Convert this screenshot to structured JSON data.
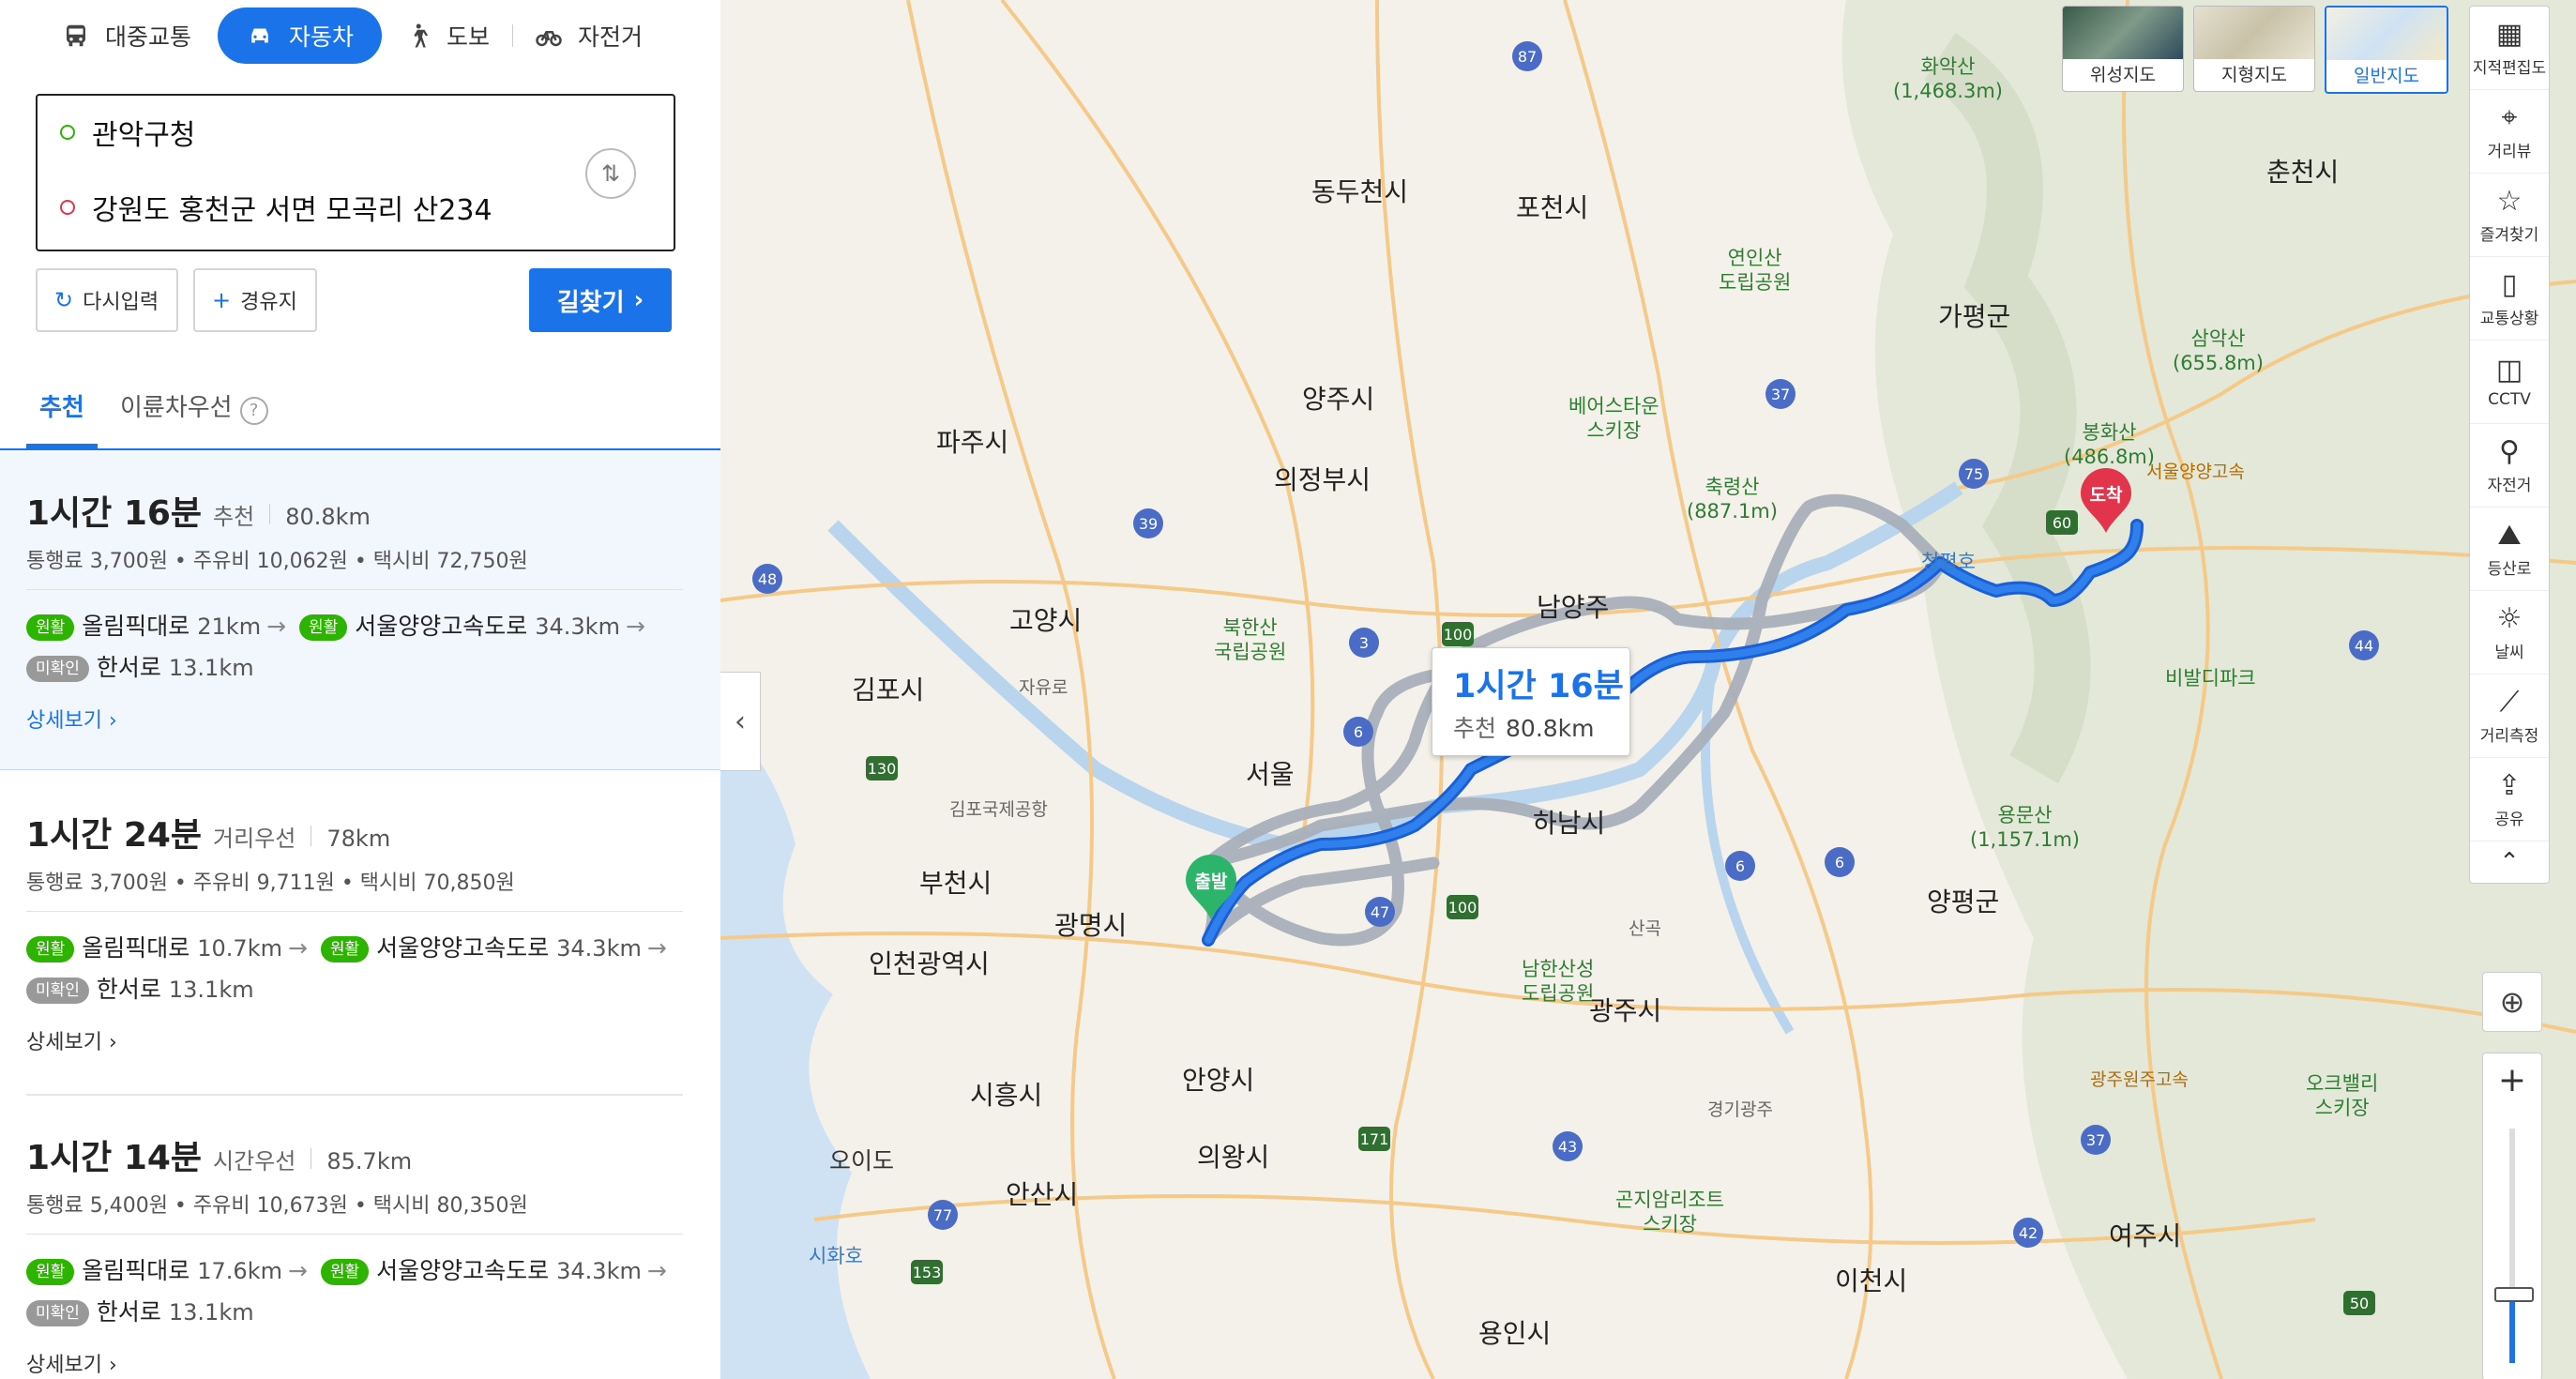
{
  "modes": [
    {
      "label": "대중교통",
      "icon": "bus-icon"
    },
    {
      "label": "자동차",
      "icon": "car-icon",
      "active": true
    },
    {
      "label": "도보",
      "icon": "walk-icon"
    },
    {
      "label": "자전거",
      "icon": "bicycle-icon"
    }
  ],
  "origin": "관악구청",
  "destination": "강원도 홍천군 서면 모곡리 산234",
  "buttons": {
    "reset": "다시입력",
    "waypoint": "경유지",
    "find": "길찾기"
  },
  "tabs": [
    "추천",
    "이륜차우선"
  ],
  "routes": [
    {
      "time": "1시간 16분",
      "tag": "추천",
      "distance": "80.8km",
      "costs": "통행료 3,700원 • 주유비 10,062원 • 택시비 72,750원",
      "roads": [
        {
          "badge": "원활",
          "name": "올림픽대로",
          "km": "21km"
        },
        {
          "badge": "원활",
          "name": "서울양양고속도로",
          "km": "34.3km"
        },
        {
          "badge": "미확인",
          "name": "한서로",
          "km": "13.1km"
        }
      ],
      "more": "상세보기"
    },
    {
      "time": "1시간 24분",
      "tag": "거리우선",
      "distance": "78km",
      "costs": "통행료 3,700원 • 주유비 9,711원 • 택시비 70,850원",
      "roads": [
        {
          "badge": "원활",
          "name": "올림픽대로",
          "km": "10.7km"
        },
        {
          "badge": "원활",
          "name": "서울양양고속도로",
          "km": "34.3km"
        },
        {
          "badge": "미확인",
          "name": "한서로",
          "km": "13.1km"
        }
      ],
      "more": "상세보기"
    },
    {
      "time": "1시간 14분",
      "tag": "시간우선",
      "distance": "85.7km",
      "costs": "통행료 5,400원 • 주유비 10,673원 • 택시비 80,350원",
      "roads": [
        {
          "badge": "원활",
          "name": "올림픽대로",
          "km": "17.6km"
        },
        {
          "badge": "원활",
          "name": "서울양양고속도로",
          "km": "34.3km"
        },
        {
          "badge": "미확인",
          "name": "한서로",
          "km": "13.1km"
        }
      ],
      "more": "상세보기"
    }
  ],
  "map": {
    "callout": {
      "time": "1시간 16분",
      "tag": "추천",
      "distance": "80.8km"
    },
    "start_pin": "출발",
    "end_pin": "도착",
    "map_types": [
      "위성지도",
      "지형지도",
      "일반지도"
    ],
    "active_map_type": "일반지도",
    "tools": [
      {
        "label": "지적편집도",
        "icon": "grid-icon"
      },
      {
        "label": "거리뷰",
        "icon": "pin-icon"
      },
      {
        "label": "즐겨찾기",
        "icon": "star-icon"
      },
      {
        "label": "교통상황",
        "icon": "traffic-light-icon"
      },
      {
        "label": "CCTV",
        "icon": "cctv-icon"
      },
      {
        "label": "자전거",
        "icon": "bicycle-icon"
      },
      {
        "label": "등산로",
        "icon": "mountain-icon"
      },
      {
        "label": "날씨",
        "icon": "sun-icon"
      },
      {
        "label": "거리측정",
        "icon": "ruler-icon"
      },
      {
        "label": "공유",
        "icon": "share-icon"
      }
    ],
    "zoom_level_fraction": 0.3,
    "places": [
      {
        "name": "동두천시"
      },
      {
        "name": "포천시"
      },
      {
        "name": "파주시"
      },
      {
        "name": "양주시"
      },
      {
        "name": "의정부시"
      },
      {
        "name": "가평군"
      },
      {
        "name": "춘천시"
      },
      {
        "name": "고양시"
      },
      {
        "name": "김포시"
      },
      {
        "name": "서울"
      },
      {
        "name": "부천시"
      },
      {
        "name": "광명시"
      },
      {
        "name": "인천광역시"
      },
      {
        "name": "하남시"
      },
      {
        "name": "남양주"
      },
      {
        "name": "양평군"
      },
      {
        "name": "광주시"
      },
      {
        "name": "안양시"
      },
      {
        "name": "시흥시"
      },
      {
        "name": "의왕시"
      },
      {
        "name": "안산시"
      },
      {
        "name": "이천시"
      },
      {
        "name": "여주시"
      },
      {
        "name": "용인시"
      },
      {
        "name": "오이도"
      },
      {
        "name": "김포국제공항"
      },
      {
        "name": "자유로"
      },
      {
        "name": "서울양양고속"
      },
      {
        "name": "광주원주고속"
      },
      {
        "name": "경기광주"
      },
      {
        "name": "산곡"
      }
    ],
    "parks": [
      {
        "name": "화악산\n(1,468.3m)"
      },
      {
        "name": "연인산\n도립공원"
      },
      {
        "name": "베어스타운\n스키장"
      },
      {
        "name": "축령산\n(887.1m)"
      },
      {
        "name": "삼악산\n(655.8m)"
      },
      {
        "name": "봉화산\n(486.8m)"
      },
      {
        "name": "북한산\n국립공원"
      },
      {
        "name": "비발디파크"
      },
      {
        "name": "용문산\n(1,157.1m)"
      },
      {
        "name": "남한산성\n도립공원"
      },
      {
        "name": "곤지암리조트\n스키장"
      },
      {
        "name": "오크밸리\n스키장"
      },
      {
        "name": "청평호"
      },
      {
        "name": "시화호"
      }
    ]
  }
}
